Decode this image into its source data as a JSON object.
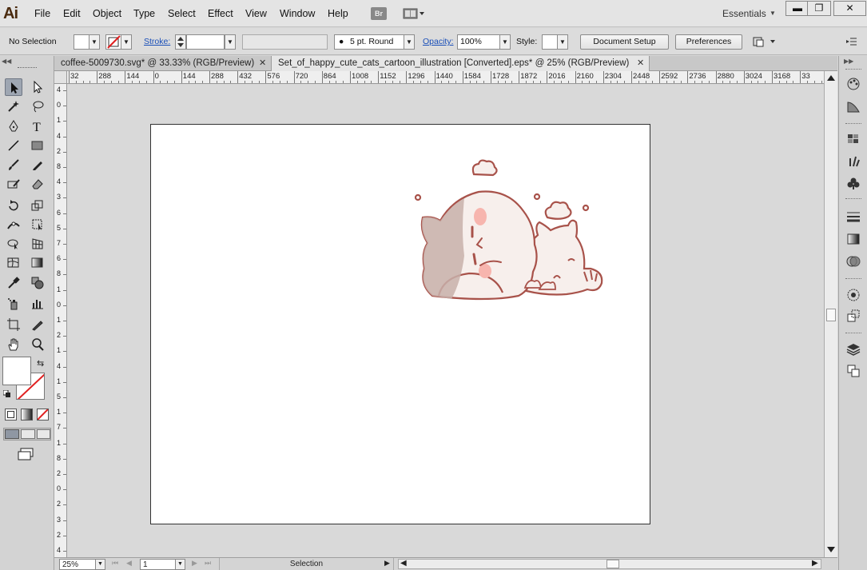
{
  "app": {
    "logo": "Ai"
  },
  "menu": {
    "items": [
      "File",
      "Edit",
      "Object",
      "Type",
      "Select",
      "Effect",
      "View",
      "Window",
      "Help"
    ],
    "bridge_label": "Br",
    "workspace": "Essentials"
  },
  "controlbar": {
    "selection": "No Selection",
    "stroke_label": "Stroke:",
    "brush_label": "5 pt. Round",
    "opacity_label": "Opacity:",
    "opacity_value": "100%",
    "style_label": "Style:",
    "document_setup": "Document Setup",
    "preferences": "Preferences"
  },
  "tabs": [
    {
      "label": "coffee-5009730.svg* @ 33.33% (RGB/Preview)",
      "active": false
    },
    {
      "label": "Set_of_happy_cute_cats_cartoon_illustration [Converted].eps* @ 25% (RGB/Preview)",
      "active": true
    }
  ],
  "ruler": {
    "top_labels": [
      "32",
      "288",
      "144",
      "0",
      "144",
      "288",
      "432",
      "576",
      "720",
      "864",
      "1008",
      "1152",
      "1296",
      "1440",
      "1584",
      "1728",
      "1872",
      "2016",
      "2160",
      "2304",
      "2448",
      "2592",
      "2736",
      "2880",
      "3024",
      "3168",
      "33"
    ],
    "left_labels": [
      "4",
      "0",
      "1",
      "4",
      "2",
      "8",
      "4",
      "3",
      "6",
      "5",
      "7",
      "6",
      "8",
      "1",
      "0",
      "1",
      "2",
      "1",
      "4",
      "1",
      "5",
      "1",
      "7",
      "1",
      "8",
      "2",
      "0",
      "2",
      "3",
      "2",
      "4"
    ]
  },
  "status": {
    "zoom": "25%",
    "artboard_number": "1",
    "tool": "Selection"
  },
  "colors": {
    "cat_outline": "#a8524a",
    "cat_fill": "#f7efec",
    "cat_patch": "#c8b0aa",
    "cheek": "#f7b5ae",
    "selected_tool": "#9ea6b2"
  }
}
